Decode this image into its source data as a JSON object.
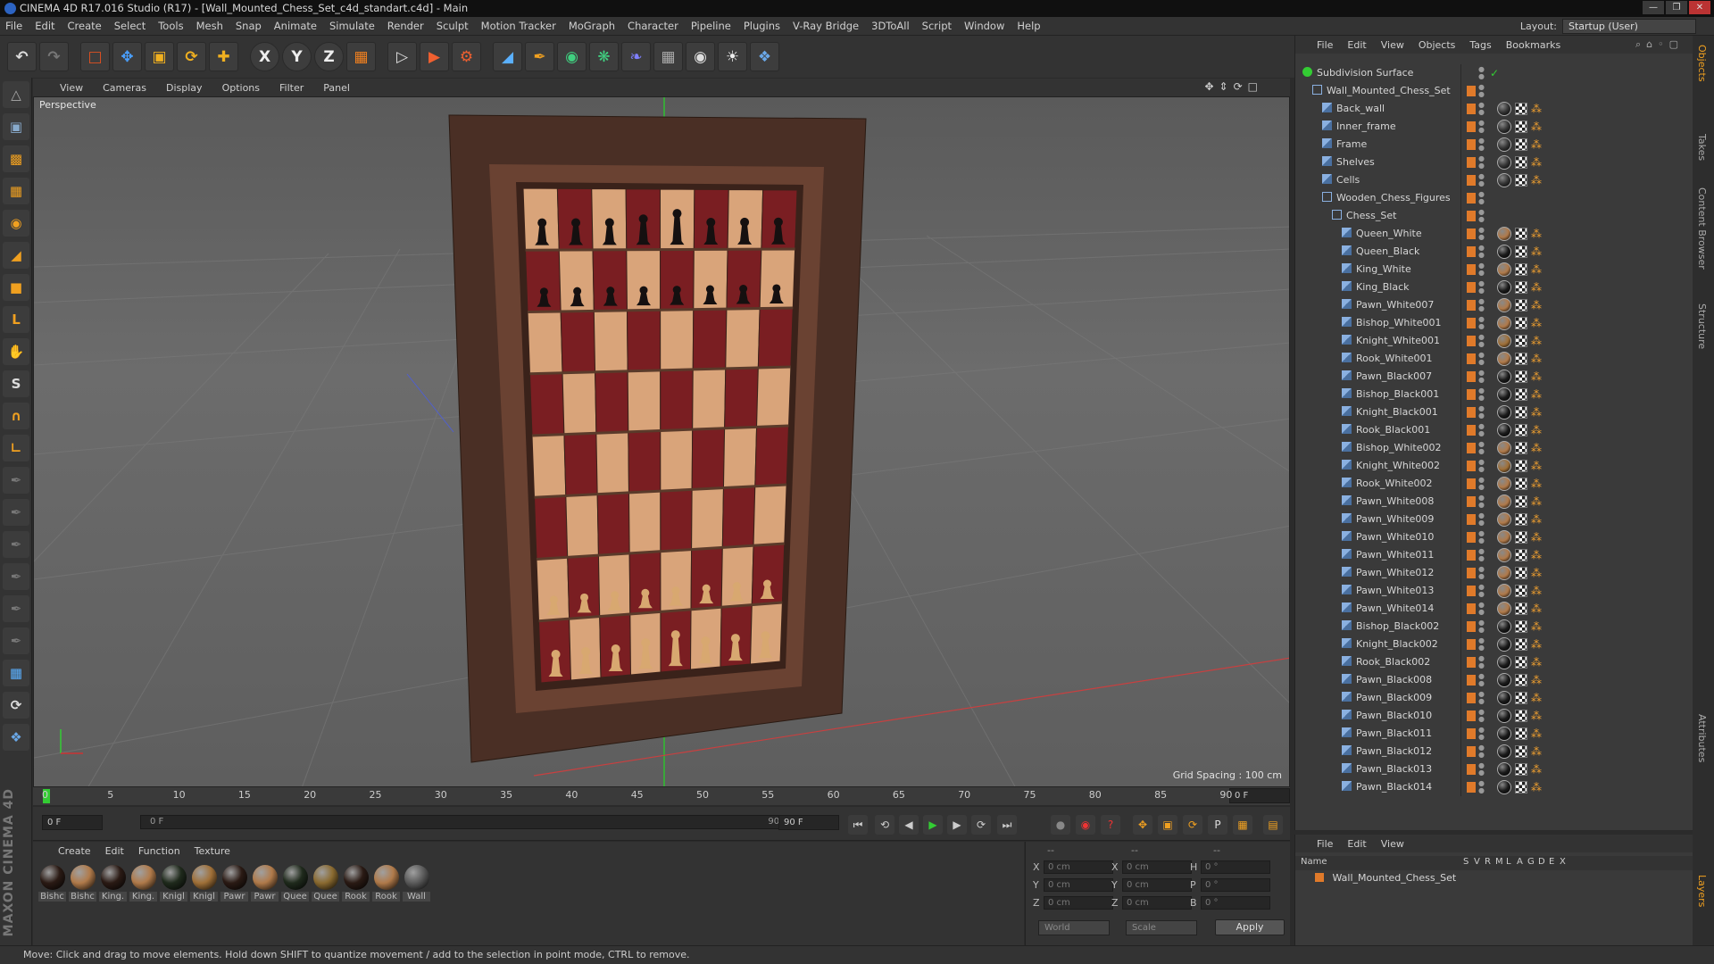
{
  "title": "CINEMA 4D R17.016 Studio (R17) - [Wall_Mounted_Chess_Set_c4d_standart.c4d] - Main",
  "menu": [
    "File",
    "Edit",
    "Create",
    "Select",
    "Tools",
    "Mesh",
    "Snap",
    "Animate",
    "Simulate",
    "Render",
    "Sculpt",
    "Motion Tracker",
    "MoGraph",
    "Character",
    "Pipeline",
    "Plugins",
    "V-Ray Bridge",
    "3DToAll",
    "Script",
    "Window",
    "Help"
  ],
  "layout": {
    "label": "Layout:",
    "value": "Startup (User)"
  },
  "toolbar": [
    "undo-icon",
    "redo-icon",
    "live-select-icon",
    "move-icon",
    "scale-icon",
    "rotate-icon",
    "add-icon",
    "x-axis-icon",
    "y-axis-icon",
    "z-axis-icon",
    "coord-system-icon",
    "render-view-icon",
    "render-picture-viewer-icon",
    "render-settings-icon",
    "cube-icon",
    "pen-spline-icon",
    "subdivision-icon",
    "array-icon",
    "deformer-icon",
    "floor-icon",
    "camera-icon",
    "light-icon",
    "python-icon"
  ],
  "toolbar_glyphs": {
    "xaxis": "X",
    "yaxis": "Y",
    "zaxis": "Z"
  },
  "viewport": {
    "menu": [
      "View",
      "Cameras",
      "Display",
      "Options",
      "Filter",
      "Panel"
    ],
    "label": "Perspective",
    "grid_spacing": "Grid Spacing : 100 cm"
  },
  "timeline": {
    "ticks": [
      "0",
      "5",
      "10",
      "15",
      "20",
      "25",
      "30",
      "35",
      "40",
      "45",
      "50",
      "55",
      "60",
      "65",
      "70",
      "75",
      "80",
      "85",
      "90"
    ],
    "current": "0 F",
    "start": "0 F",
    "slider_start": "0 F",
    "slider_end": "90 F",
    "end": "90 F",
    "end_field": "90 F"
  },
  "materials": {
    "menu": [
      "Create",
      "Edit",
      "Function",
      "Texture"
    ],
    "items": [
      {
        "label": "Bishc",
        "color": "#2a1a14"
      },
      {
        "label": "Bishc",
        "color": "#b07a4a"
      },
      {
        "label": "King.",
        "color": "#2a1a14"
      },
      {
        "label": "King.",
        "color": "#b07a4a"
      },
      {
        "label": "Knigl",
        "color": "#1f2a1c"
      },
      {
        "label": "Knigl",
        "color": "#a07038"
      },
      {
        "label": "Pawr",
        "color": "#2a1a14"
      },
      {
        "label": "Pawr",
        "color": "#b07a4a"
      },
      {
        "label": "Quee",
        "color": "#1f2a1c"
      },
      {
        "label": "Quee",
        "color": "#8a6a30"
      },
      {
        "label": "Rook",
        "color": "#2a1a14"
      },
      {
        "label": "Rook",
        "color": "#b07a4a"
      },
      {
        "label": "Wall",
        "color": "#5a5a5a"
      }
    ]
  },
  "coords": {
    "header": [
      "--",
      "--",
      "--"
    ],
    "rows": [
      {
        "a": "X",
        "av": "0 cm",
        "b": "X",
        "bv": "0 cm",
        "c": "H",
        "cv": "0 °"
      },
      {
        "a": "Y",
        "av": "0 cm",
        "b": "Y",
        "bv": "0 cm",
        "c": "P",
        "cv": "0 °"
      },
      {
        "a": "Z",
        "av": "0 cm",
        "b": "Z",
        "bv": "0 cm",
        "c": "B",
        "cv": "0 °"
      }
    ],
    "world": "World",
    "scale": "Scale",
    "apply": "Apply"
  },
  "objects": {
    "menu": [
      "File",
      "Edit",
      "View",
      "Objects",
      "Tags",
      "Bookmarks"
    ],
    "rows": [
      {
        "name": "Subdivision Surface",
        "indent": 0,
        "type": "sds",
        "tag": false,
        "check": true
      },
      {
        "name": "Wall_Mounted_Chess_Set",
        "indent": 1,
        "type": "null",
        "tag": false
      },
      {
        "name": "Back_wall",
        "indent": 2,
        "type": "poly",
        "tag": true,
        "mat": "#333"
      },
      {
        "name": "Inner_frame",
        "indent": 2,
        "type": "poly",
        "tag": true,
        "mat": "#333"
      },
      {
        "name": "Frame",
        "indent": 2,
        "type": "poly",
        "tag": true,
        "mat": "#333"
      },
      {
        "name": "Shelves",
        "indent": 2,
        "type": "poly",
        "tag": true,
        "mat": "#333"
      },
      {
        "name": "Cells",
        "indent": 2,
        "type": "poly",
        "tag": true,
        "mat": "#333"
      },
      {
        "name": "Wooden_Chess_Figures",
        "indent": 2,
        "type": "null",
        "tag": false
      },
      {
        "name": "Chess_Set",
        "indent": 3,
        "type": "null",
        "tag": false
      },
      {
        "name": "Queen_White",
        "indent": 4,
        "type": "poly",
        "tag": true,
        "mat": "#b07a4a"
      },
      {
        "name": "Queen_Black",
        "indent": 4,
        "type": "poly",
        "tag": true,
        "mat": "#1a1a1a"
      },
      {
        "name": "King_White",
        "indent": 4,
        "type": "poly",
        "tag": true,
        "mat": "#b07a4a"
      },
      {
        "name": "King_Black",
        "indent": 4,
        "type": "poly",
        "tag": true,
        "mat": "#1a1a1a"
      },
      {
        "name": "Pawn_White007",
        "indent": 4,
        "type": "poly",
        "tag": true,
        "mat": "#b07a4a"
      },
      {
        "name": "Bishop_White001",
        "indent": 4,
        "type": "poly",
        "tag": true,
        "mat": "#b07a4a"
      },
      {
        "name": "Knight_White001",
        "indent": 4,
        "type": "poly",
        "tag": true,
        "mat": "#a07038"
      },
      {
        "name": "Rook_White001",
        "indent": 4,
        "type": "poly",
        "tag": true,
        "mat": "#b07a4a"
      },
      {
        "name": "Pawn_Black007",
        "indent": 4,
        "type": "poly",
        "tag": true,
        "mat": "#1a1a1a"
      },
      {
        "name": "Bishop_Black001",
        "indent": 4,
        "type": "poly",
        "tag": true,
        "mat": "#1a1a1a"
      },
      {
        "name": "Knight_Black001",
        "indent": 4,
        "type": "poly",
        "tag": true,
        "mat": "#1a1a1a"
      },
      {
        "name": "Rook_Black001",
        "indent": 4,
        "type": "poly",
        "tag": true,
        "mat": "#1a1a1a"
      },
      {
        "name": "Bishop_White002",
        "indent": 4,
        "type": "poly",
        "tag": true,
        "mat": "#b07a4a"
      },
      {
        "name": "Knight_White002",
        "indent": 4,
        "type": "poly",
        "tag": true,
        "mat": "#a07038"
      },
      {
        "name": "Rook_White002",
        "indent": 4,
        "type": "poly",
        "tag": true,
        "mat": "#b07a4a"
      },
      {
        "name": "Pawn_White008",
        "indent": 4,
        "type": "poly",
        "tag": true,
        "mat": "#b07a4a"
      },
      {
        "name": "Pawn_White009",
        "indent": 4,
        "type": "poly",
        "tag": true,
        "mat": "#b07a4a"
      },
      {
        "name": "Pawn_White010",
        "indent": 4,
        "type": "poly",
        "tag": true,
        "mat": "#b07a4a"
      },
      {
        "name": "Pawn_White011",
        "indent": 4,
        "type": "poly",
        "tag": true,
        "mat": "#b07a4a"
      },
      {
        "name": "Pawn_White012",
        "indent": 4,
        "type": "poly",
        "tag": true,
        "mat": "#b07a4a"
      },
      {
        "name": "Pawn_White013",
        "indent": 4,
        "type": "poly",
        "tag": true,
        "mat": "#b07a4a"
      },
      {
        "name": "Pawn_White014",
        "indent": 4,
        "type": "poly",
        "tag": true,
        "mat": "#b07a4a"
      },
      {
        "name": "Bishop_Black002",
        "indent": 4,
        "type": "poly",
        "tag": true,
        "mat": "#1a1a1a"
      },
      {
        "name": "Knight_Black002",
        "indent": 4,
        "type": "poly",
        "tag": true,
        "mat": "#1a1a1a"
      },
      {
        "name": "Rook_Black002",
        "indent": 4,
        "type": "poly",
        "tag": true,
        "mat": "#1a1a1a"
      },
      {
        "name": "Pawn_Black008",
        "indent": 4,
        "type": "poly",
        "tag": true,
        "mat": "#1a1a1a"
      },
      {
        "name": "Pawn_Black009",
        "indent": 4,
        "type": "poly",
        "tag": true,
        "mat": "#1a1a1a"
      },
      {
        "name": "Pawn_Black010",
        "indent": 4,
        "type": "poly",
        "tag": true,
        "mat": "#1a1a1a"
      },
      {
        "name": "Pawn_Black011",
        "indent": 4,
        "type": "poly",
        "tag": true,
        "mat": "#1a1a1a"
      },
      {
        "name": "Pawn_Black012",
        "indent": 4,
        "type": "poly",
        "tag": true,
        "mat": "#1a1a1a"
      },
      {
        "name": "Pawn_Black013",
        "indent": 4,
        "type": "poly",
        "tag": true,
        "mat": "#1a1a1a"
      },
      {
        "name": "Pawn_Black014",
        "indent": 4,
        "type": "poly",
        "tag": true,
        "mat": "#1a1a1a"
      }
    ]
  },
  "layers": {
    "menu": [
      "File",
      "Edit",
      "View"
    ],
    "header_name": "Name",
    "header_cols": [
      "S",
      "V",
      "R",
      "M",
      "L",
      "A",
      "G",
      "D",
      "E",
      "X"
    ],
    "row": "Wall_Mounted_Chess_Set"
  },
  "right_tabs": [
    "Objects",
    "Takes",
    "Content Browser",
    "Structure",
    "Attributes",
    "Layers"
  ],
  "branding": "MAXON CINEMA 4D",
  "status": "Move: Click and drag to move elements. Hold down SHIFT to quantize movement / add to the selection in point mode, CTRL to remove.",
  "colors": {
    "tag_orange": "#e07a2a",
    "accent_blue": "#2c63c2"
  }
}
